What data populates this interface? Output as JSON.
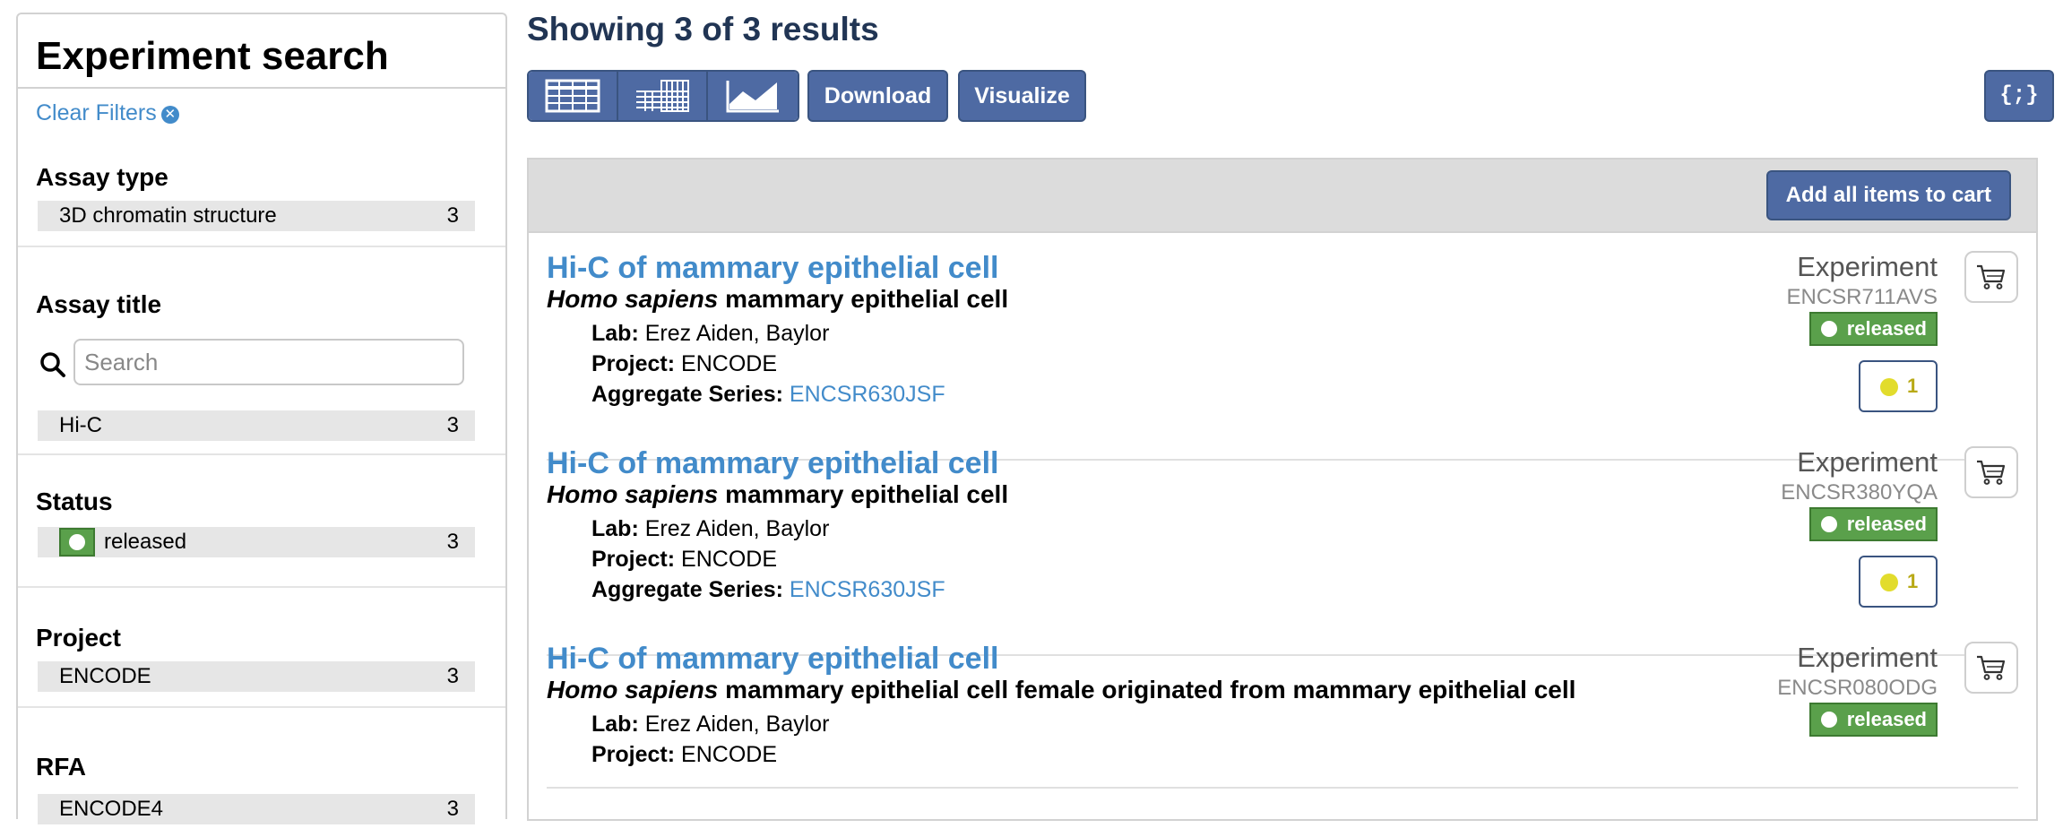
{
  "facets": {
    "title": "Experiment search",
    "clear_filters": "Clear Filters",
    "groups": [
      {
        "heading": "Assay type",
        "terms": [
          {
            "label": "3D chromatin structure",
            "count": "3"
          }
        ]
      },
      {
        "heading": "Assay title",
        "search_placeholder": "Search",
        "terms": [
          {
            "label": "Hi-C",
            "count": "3"
          }
        ]
      },
      {
        "heading": "Status",
        "terms": [
          {
            "label": "released",
            "count": "3",
            "color": "#5aa04b"
          }
        ]
      },
      {
        "heading": "Project",
        "terms": [
          {
            "label": "ENCODE",
            "count": "3"
          }
        ]
      },
      {
        "heading": "RFA",
        "terms": [
          {
            "label": "ENCODE4",
            "count": "3"
          }
        ]
      }
    ]
  },
  "header": {
    "results_text": "Showing 3 of 3 results",
    "view_buttons": [
      "table-view-icon",
      "matrix-view-icon",
      "chart-view-icon"
    ],
    "download_label": "Download",
    "visualize_label": "Visualize",
    "json_label": "{;}"
  },
  "results_bar": {
    "add_all_label": "Add all items to cart"
  },
  "results": [
    {
      "title": "Hi-C of mammary epithelial cell",
      "organism": "Homo sapiens",
      "biosample": "mammary epithelial cell",
      "lab_label": "Lab:",
      "lab": "Erez Aiden, Baylor",
      "project_label": "Project:",
      "project": "ENCODE",
      "series_label": "Aggregate Series:",
      "series": "ENCSR630JSF",
      "type": "Experiment",
      "accession": "ENCSR711AVS",
      "status": "released",
      "audit_count": "1"
    },
    {
      "title": "Hi-C of mammary epithelial cell",
      "organism": "Homo sapiens",
      "biosample": "mammary epithelial cell",
      "lab_label": "Lab:",
      "lab": "Erez Aiden, Baylor",
      "project_label": "Project:",
      "project": "ENCODE",
      "series_label": "Aggregate Series:",
      "series": "ENCSR630JSF",
      "type": "Experiment",
      "accession": "ENCSR380YQA",
      "status": "released",
      "audit_count": "1"
    },
    {
      "title": "Hi-C of mammary epithelial cell",
      "organism": "Homo sapiens",
      "biosample": "mammary epithelial cell female originated from mammary epithelial cell",
      "lab_label": "Lab:",
      "lab": "Erez Aiden, Baylor",
      "project_label": "Project:",
      "project": "ENCODE",
      "type": "Experiment",
      "accession": "ENCSR080ODG",
      "status": "released"
    }
  ],
  "colors": {
    "brand_blue": "#4e6aa3",
    "link_blue": "#428bca",
    "status_green": "#5aa04b",
    "audit_yellow": "#e2dc2c"
  }
}
